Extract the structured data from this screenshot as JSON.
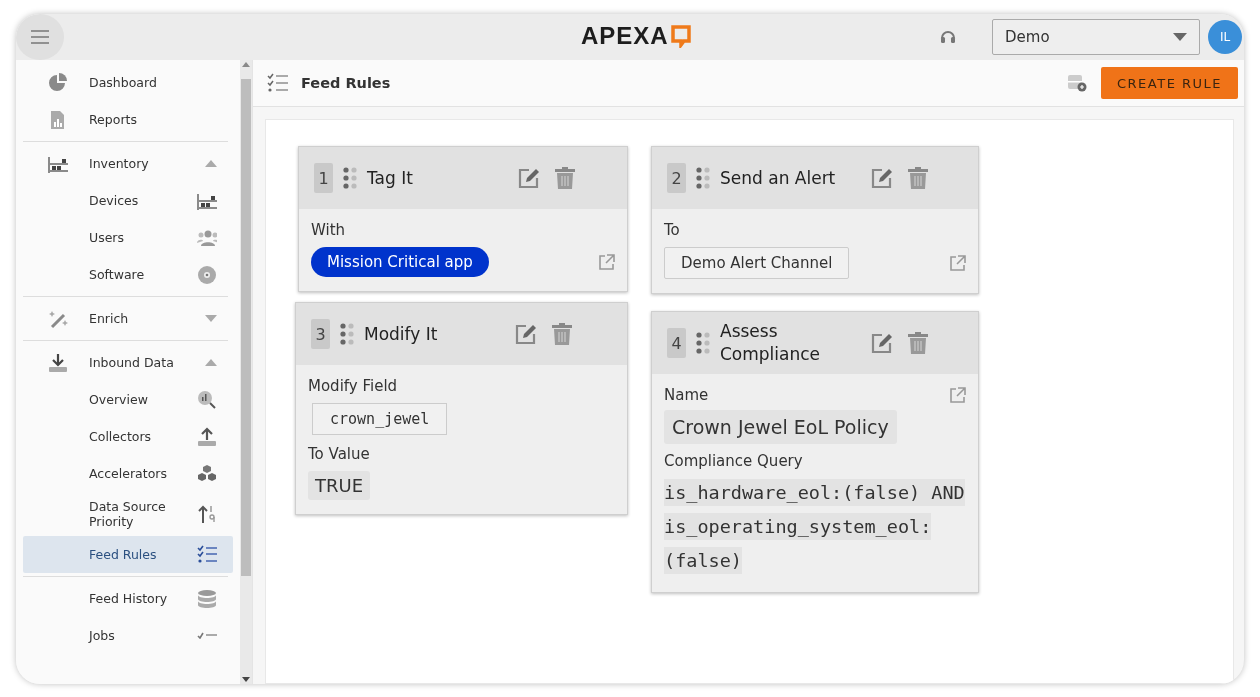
{
  "header": {
    "logo": "APEXA",
    "tenant_select": {
      "value": "Demo"
    },
    "avatar": "IL"
  },
  "sidebar": {
    "items": [
      {
        "label": "Dashboard",
        "selected": false
      },
      {
        "label": "Reports",
        "selected": false
      },
      {
        "label": "Inventory",
        "selected": false,
        "expanded": true,
        "children": [
          {
            "label": "Devices",
            "selected": false
          },
          {
            "label": "Users",
            "selected": false
          },
          {
            "label": "Software",
            "selected": false
          }
        ]
      },
      {
        "label": "Enrich",
        "selected": false,
        "expanded": false
      },
      {
        "label": "Inbound Data",
        "selected": false,
        "expanded": true,
        "children": [
          {
            "label": "Overview",
            "selected": false
          },
          {
            "label": "Collectors",
            "selected": false
          },
          {
            "label": "Accelerators",
            "selected": false
          },
          {
            "label": "Data Source Priority",
            "selected": false
          },
          {
            "label": "Feed Rules",
            "selected": true
          },
          {
            "label": "Feed History",
            "selected": false
          },
          {
            "label": "Jobs",
            "selected": false
          }
        ]
      }
    ]
  },
  "page": {
    "title": "Feed Rules",
    "create_button": "CREATE RULE"
  },
  "rules": [
    {
      "kind": "tag",
      "number": "1",
      "title": "Tag It",
      "label": "With",
      "tag": "Mission Critical app"
    },
    {
      "kind": "alert",
      "number": "2",
      "title": "Send an Alert",
      "label": "To",
      "channel": "Demo Alert Channel"
    },
    {
      "kind": "modify",
      "number": "3",
      "title": "Modify It",
      "field_label": "Modify Field",
      "field": "crown_jewel",
      "value_label": "To Value",
      "value": "TRUE"
    },
    {
      "kind": "compliance",
      "number": "4",
      "title": "Assess Compliance",
      "name_label": "Name",
      "name": "Crown Jewel EoL Policy",
      "query_label": "Compliance Query",
      "query": "is_hardware_eol:(false) AND is_operating_system_eol:(false)"
    }
  ]
}
